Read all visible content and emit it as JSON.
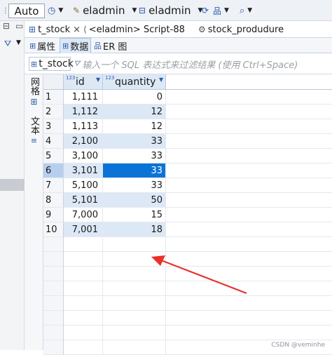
{
  "toolbar": {
    "auto_label": "Auto",
    "datasource": "eladmin",
    "schema": "eladmin"
  },
  "editor_tabs": [
    {
      "label": "t_stock",
      "close": "×"
    },
    {
      "label": "<eladmin> Script-88"
    },
    {
      "label": "stock_produdure"
    }
  ],
  "sub_tabs": [
    {
      "label": "属性"
    },
    {
      "label": "数据"
    },
    {
      "label": "ER 图"
    }
  ],
  "filter": {
    "entity": "t_stock",
    "placeholder": "输入一个 SQL 表达式来过滤结果 (使用 Ctrl+Space)"
  },
  "side_tabs": [
    {
      "label": "网格"
    },
    {
      "label": "文本"
    }
  ],
  "grid": {
    "columns": [
      {
        "label": "id",
        "type_badge": "123"
      },
      {
        "label": "quantity",
        "type_badge": "123"
      }
    ],
    "rows": [
      {
        "n": "1",
        "id": "1,111",
        "quantity": "0"
      },
      {
        "n": "2",
        "id": "1,112",
        "quantity": "12"
      },
      {
        "n": "3",
        "id": "1,113",
        "quantity": "12"
      },
      {
        "n": "4",
        "id": "2,100",
        "quantity": "33"
      },
      {
        "n": "5",
        "id": "3,100",
        "quantity": "33"
      },
      {
        "n": "6",
        "id": "3,101",
        "quantity": "33"
      },
      {
        "n": "7",
        "id": "5,100",
        "quantity": "33"
      },
      {
        "n": "8",
        "id": "5,101",
        "quantity": "50"
      },
      {
        "n": "9",
        "id": "7,000",
        "quantity": "15"
      },
      {
        "n": "10",
        "id": "7,001",
        "quantity": "18"
      }
    ],
    "selected_row": 6
  },
  "annotation": {
    "color": "#e8312a"
  },
  "credit": "CSDN @veminhe"
}
